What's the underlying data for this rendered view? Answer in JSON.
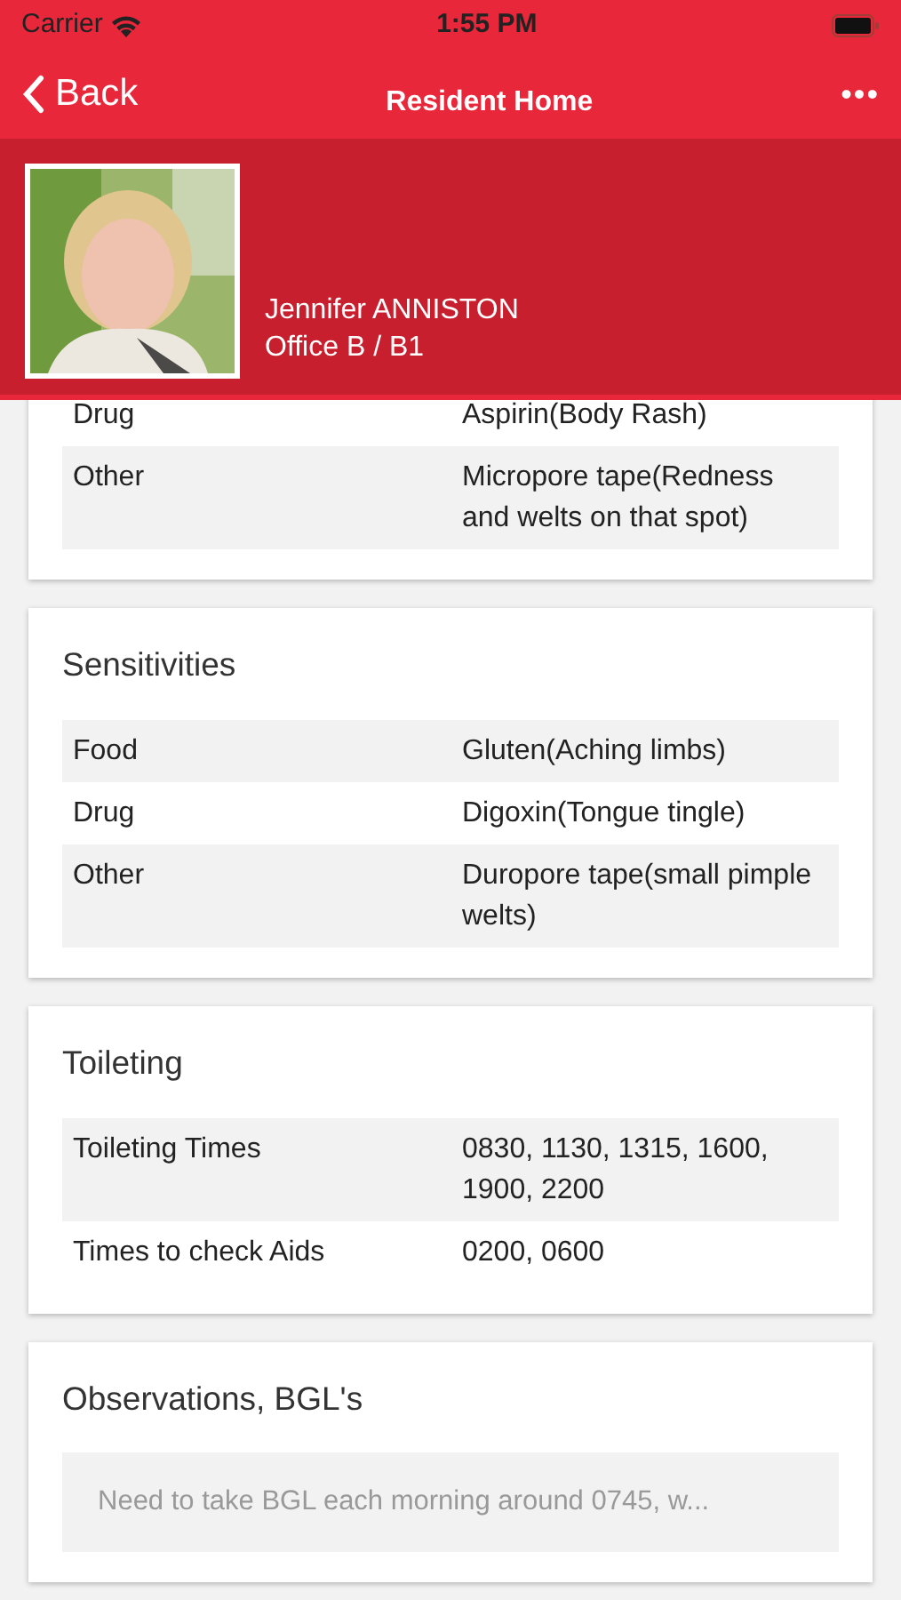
{
  "status_bar": {
    "carrier": "Carrier",
    "time": "1:55 PM"
  },
  "nav": {
    "back": "Back",
    "title": "Resident Home",
    "more": "•••"
  },
  "profile": {
    "name": "Jennifer ANNISTON",
    "location": "Office B / B1"
  },
  "sections": [
    {
      "rows": [
        {
          "label": "Drug",
          "value": "Aspirin(Body Rash)"
        },
        {
          "label": "Other",
          "value": "Micropore tape(Redness and welts on that spot)"
        }
      ]
    },
    {
      "title": "Sensitivities",
      "rows": [
        {
          "label": "Food",
          "value": "Gluten(Aching limbs)"
        },
        {
          "label": "Drug",
          "value": "Digoxin(Tongue tingle)"
        },
        {
          "label": "Other",
          "value": "Duropore tape(small pimple welts)"
        }
      ]
    },
    {
      "title": "Toileting",
      "rows": [
        {
          "label": "Toileting Times",
          "value": "0830, 1130, 1315, 1600, 1900, 2200"
        },
        {
          "label": "Times to check Aids",
          "value": "0200, 0600"
        }
      ]
    }
  ],
  "observations": {
    "title": "Observations, BGL's",
    "placeholder": "Need to take BGL each morning around 0745, w..."
  }
}
